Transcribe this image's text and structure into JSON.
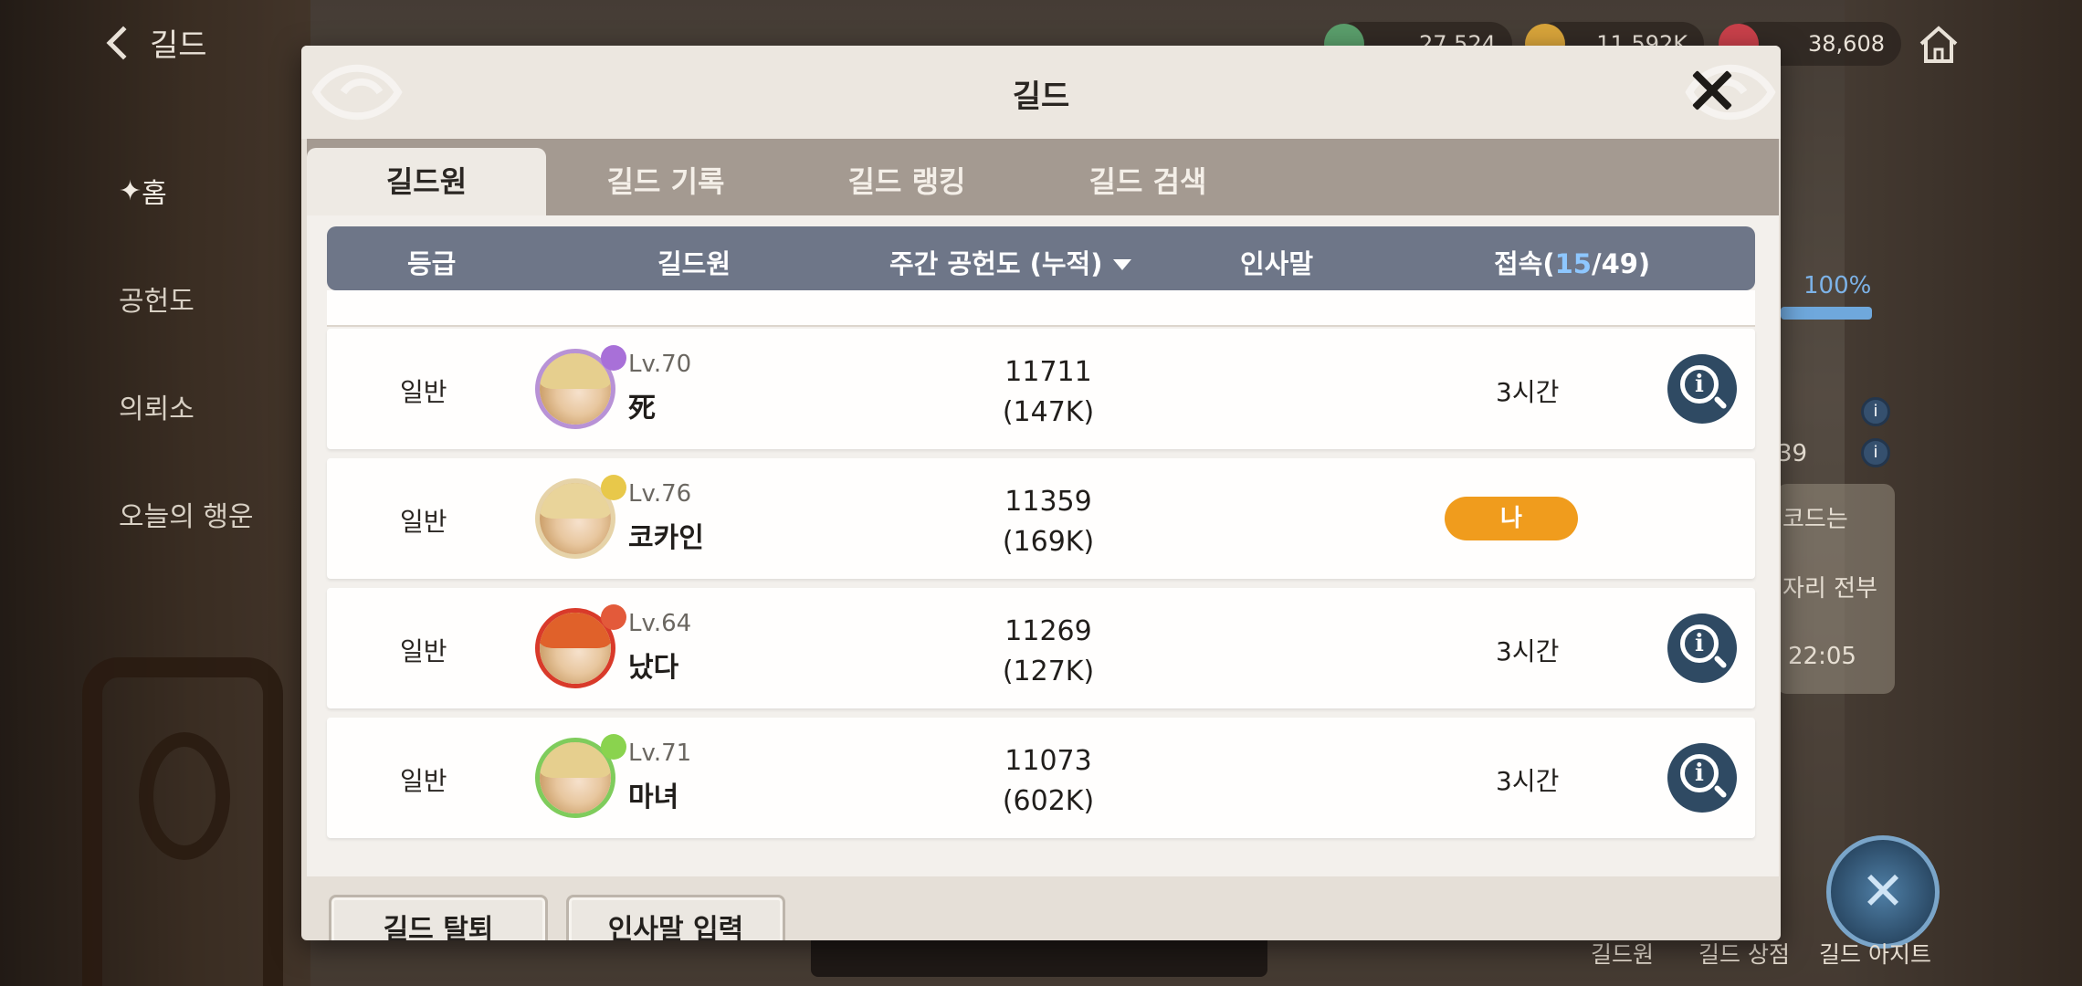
{
  "hud": {
    "back_label": "길드",
    "resources": [
      {
        "icon": "gem-currency-icon",
        "value": "27,524",
        "color": "#5a9e6b"
      },
      {
        "icon": "gold-coin-icon",
        "value": "11,592K",
        "color": "#d8a43a"
      },
      {
        "icon": "red-gem-icon",
        "value": "38,608",
        "color": "#c9404a"
      }
    ]
  },
  "side_menu": {
    "home": "홈",
    "items": [
      "공헌도",
      "의뢰소",
      "오늘의 행운"
    ]
  },
  "right_panel": {
    "percent": "100%",
    "value_39": "39",
    "notice_1": "코드는",
    "notice_2": "자리 전부",
    "time": "22:05"
  },
  "bottom_nav": {
    "items": [
      "길드원",
      "길드 상점",
      "길드 아지트"
    ]
  },
  "modal": {
    "title": "길드",
    "tabs": [
      "길드원",
      "길드 기록",
      "길드 랭킹",
      "길드 검색"
    ],
    "active_tab": 0,
    "columns": {
      "grade": "등급",
      "member": "길드원",
      "contribution": "주간 공헌도 (누적)",
      "greeting": "인사말",
      "access_prefix": "접속(",
      "access_online": "15",
      "access_suffix": "/49)"
    },
    "rows": [
      {
        "grade": "일반",
        "level": "Lv.70",
        "name": "死",
        "weekly": "11711",
        "cumulative": "(147K)",
        "access": "3시간",
        "is_me": false,
        "frame_color": "#b892d6",
        "hair_color": "#e6cf8e",
        "badge_color": "#a870d8"
      },
      {
        "grade": "일반",
        "level": "Lv.76",
        "name": "코카인",
        "weekly": "11359",
        "cumulative": "(169K)",
        "access": "나",
        "is_me": true,
        "frame_color": "#e6d3a8",
        "hair_color": "#e9d49a",
        "badge_color": "#e8c84a"
      },
      {
        "grade": "일반",
        "level": "Lv.64",
        "name": "났다",
        "weekly": "11269",
        "cumulative": "(127K)",
        "access": "3시간",
        "is_me": false,
        "frame_color": "#d93a2a",
        "hair_color": "#e0612a",
        "badge_color": "#e35a3a"
      },
      {
        "grade": "일반",
        "level": "Lv.71",
        "name": "마녀",
        "weekly": "11073",
        "cumulative": "(602K)",
        "access": "3시간",
        "is_me": false,
        "frame_color": "#7fcc5c",
        "hair_color": "#e6cf8e",
        "badge_color": "#8ad34e"
      }
    ],
    "buttons": {
      "leave": "길드 탈퇴",
      "greeting": "인사말 입력"
    }
  }
}
